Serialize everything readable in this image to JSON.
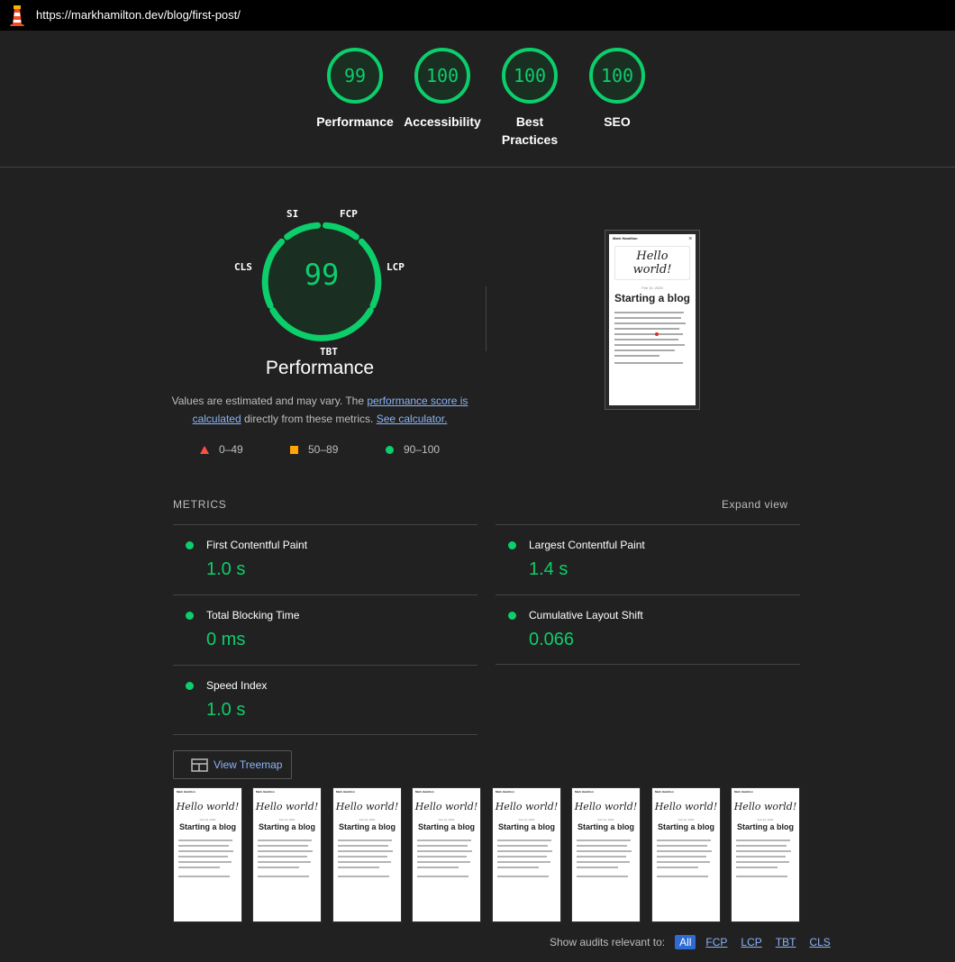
{
  "topbar": {
    "url": "https://markhamilton.dev/blog/first-post/"
  },
  "colors": {
    "pass": "#0cce6b",
    "average": "#ffa400",
    "fail": "#ff4e42",
    "link": "#8ab4f8",
    "active_filter": "#2f6bd5"
  },
  "gauges": [
    {
      "score": "99",
      "label": "Performance"
    },
    {
      "score": "100",
      "label": "Accessibility"
    },
    {
      "score": "100",
      "label": "Best Practices"
    },
    {
      "score": "100",
      "label": "SEO"
    }
  ],
  "performance": {
    "score": "99",
    "title": "Performance",
    "metric_labels": {
      "si": "SI",
      "fcp": "FCP",
      "lcp": "LCP",
      "tbt": "TBT",
      "cls": "CLS"
    },
    "desc_prefix": "Values are estimated and may vary. The ",
    "desc_link1": "performance score is calculated",
    "desc_middle": " directly from these metrics. ",
    "desc_link2": "See calculator.",
    "legend": {
      "fail": "0–49",
      "average": "50–89",
      "pass": "90–100"
    }
  },
  "screenshot": {
    "header": "Mark Hamilton",
    "hello": "Hello world!",
    "date": "Feb 10, 2020",
    "title": "Starting a blog"
  },
  "metrics": {
    "heading": "METRICS",
    "expand": "Expand view",
    "fcp": {
      "title": "First Contentful Paint",
      "value": "1.0 s"
    },
    "lcp": {
      "title": "Largest Contentful Paint",
      "value": "1.4 s"
    },
    "tbt": {
      "title": "Total Blocking Time",
      "value": "0 ms"
    },
    "cls": {
      "title": "Cumulative Layout Shift",
      "value": "0.066"
    },
    "si": {
      "title": "Speed Index",
      "value": "1.0 s"
    }
  },
  "treemap": {
    "label": "View Treemap"
  },
  "filmstrip": {
    "header": "Mark Hamilton",
    "hello": "Hello world!",
    "date": "Feb 10, 2020",
    "title": "Starting a blog"
  },
  "filters": {
    "label": "Show audits relevant to:",
    "all": "All",
    "fcp": "FCP",
    "lcp": "LCP",
    "tbt": "TBT",
    "cls": "CLS"
  }
}
